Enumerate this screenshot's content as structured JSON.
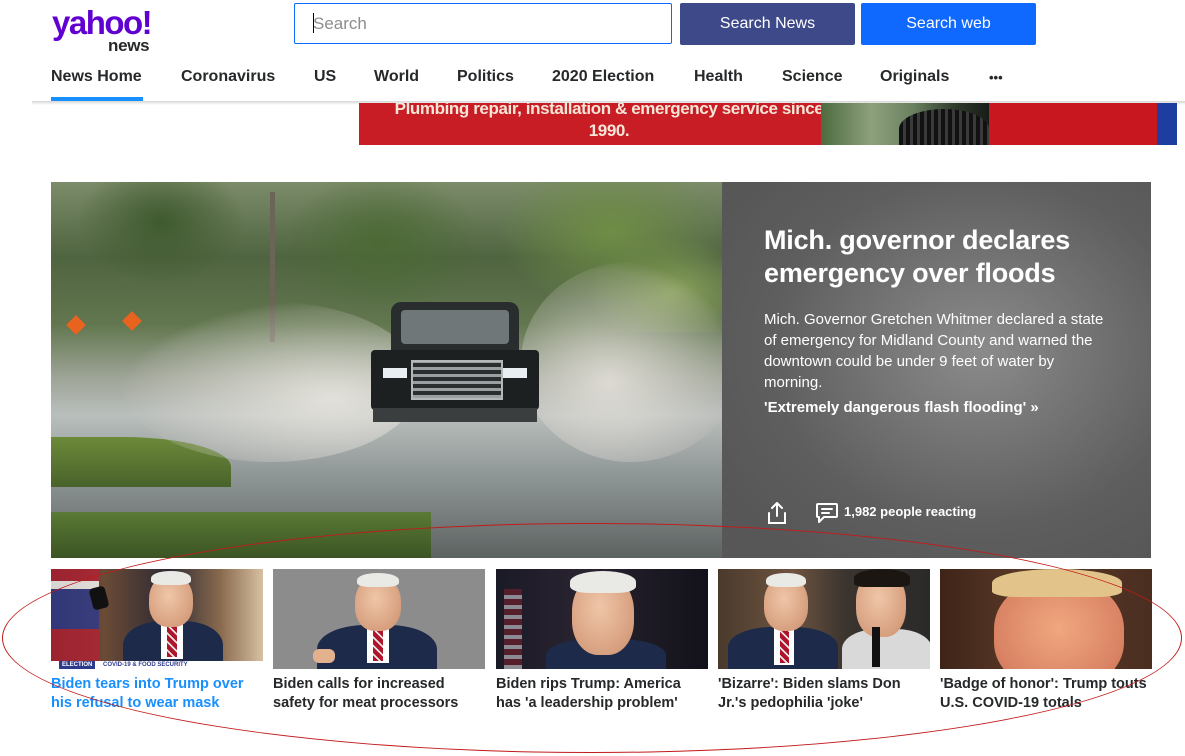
{
  "header": {
    "logo_text": "yahoo!",
    "logo_sub": "news",
    "search_placeholder": "Search",
    "search_news_label": "Search News",
    "search_web_label": "Search web"
  },
  "nav": {
    "items": [
      "News Home",
      "Coronavirus",
      "US",
      "World",
      "Politics",
      "2020 Election",
      "Health",
      "Science",
      "Originals"
    ],
    "more": "•••",
    "active": "News Home"
  },
  "ad": {
    "text_line1": "Plumbing repair, installation & emergency service since",
    "text_line2": "1990."
  },
  "hero": {
    "title": "Mich. governor declares emergency over floods",
    "summary": "Mich. Governor Gretchen Whitmer declared a state of emergency for Midland County and warned the downtown could be under 9 feet of water by morning.",
    "link": "'Extremely dangerous flash flooding' »",
    "reacting": "1,982 people reacting"
  },
  "stories": [
    {
      "title": "Biden tears into Trump over his refusal to wear mask",
      "tag1": "ELECTION",
      "tag2": "COVID-19 & FOOD SECURITY"
    },
    {
      "title": "Biden calls for increased safety for meat processors"
    },
    {
      "title": "Biden rips Trump: America has 'a leadership problem'"
    },
    {
      "title": "'Bizarre': Biden slams Don Jr.'s pedophilia 'joke'"
    },
    {
      "title": "'Badge of honor': Trump touts U.S. COVID-19 totals"
    }
  ],
  "colors": {
    "brand_purple": "#6001d2",
    "search_news_btn": "#3e4989",
    "search_web_btn": "#0f69ff",
    "nav_active_underline": "#188fff",
    "annotation_circle": "#c21a1a"
  }
}
